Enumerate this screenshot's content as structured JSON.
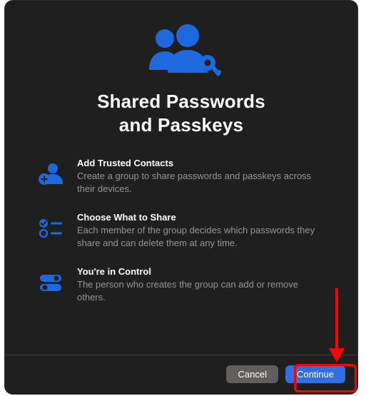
{
  "title_line1": "Shared Passwords",
  "title_line2": "and Passkeys",
  "features": [
    {
      "title": "Add Trusted Contacts",
      "desc": "Create a group to share passwords and passkeys across their devices."
    },
    {
      "title": "Choose What to Share",
      "desc": "Each member of the group decides which passwords they share and can delete them at any time."
    },
    {
      "title": "You're in Control",
      "desc": "The person who creates the group can add or remove others."
    }
  ],
  "buttons": {
    "cancel": "Cancel",
    "continue": "Continue"
  },
  "colors": {
    "accent": "#2f6fe1",
    "icon": "#1e68e0"
  }
}
